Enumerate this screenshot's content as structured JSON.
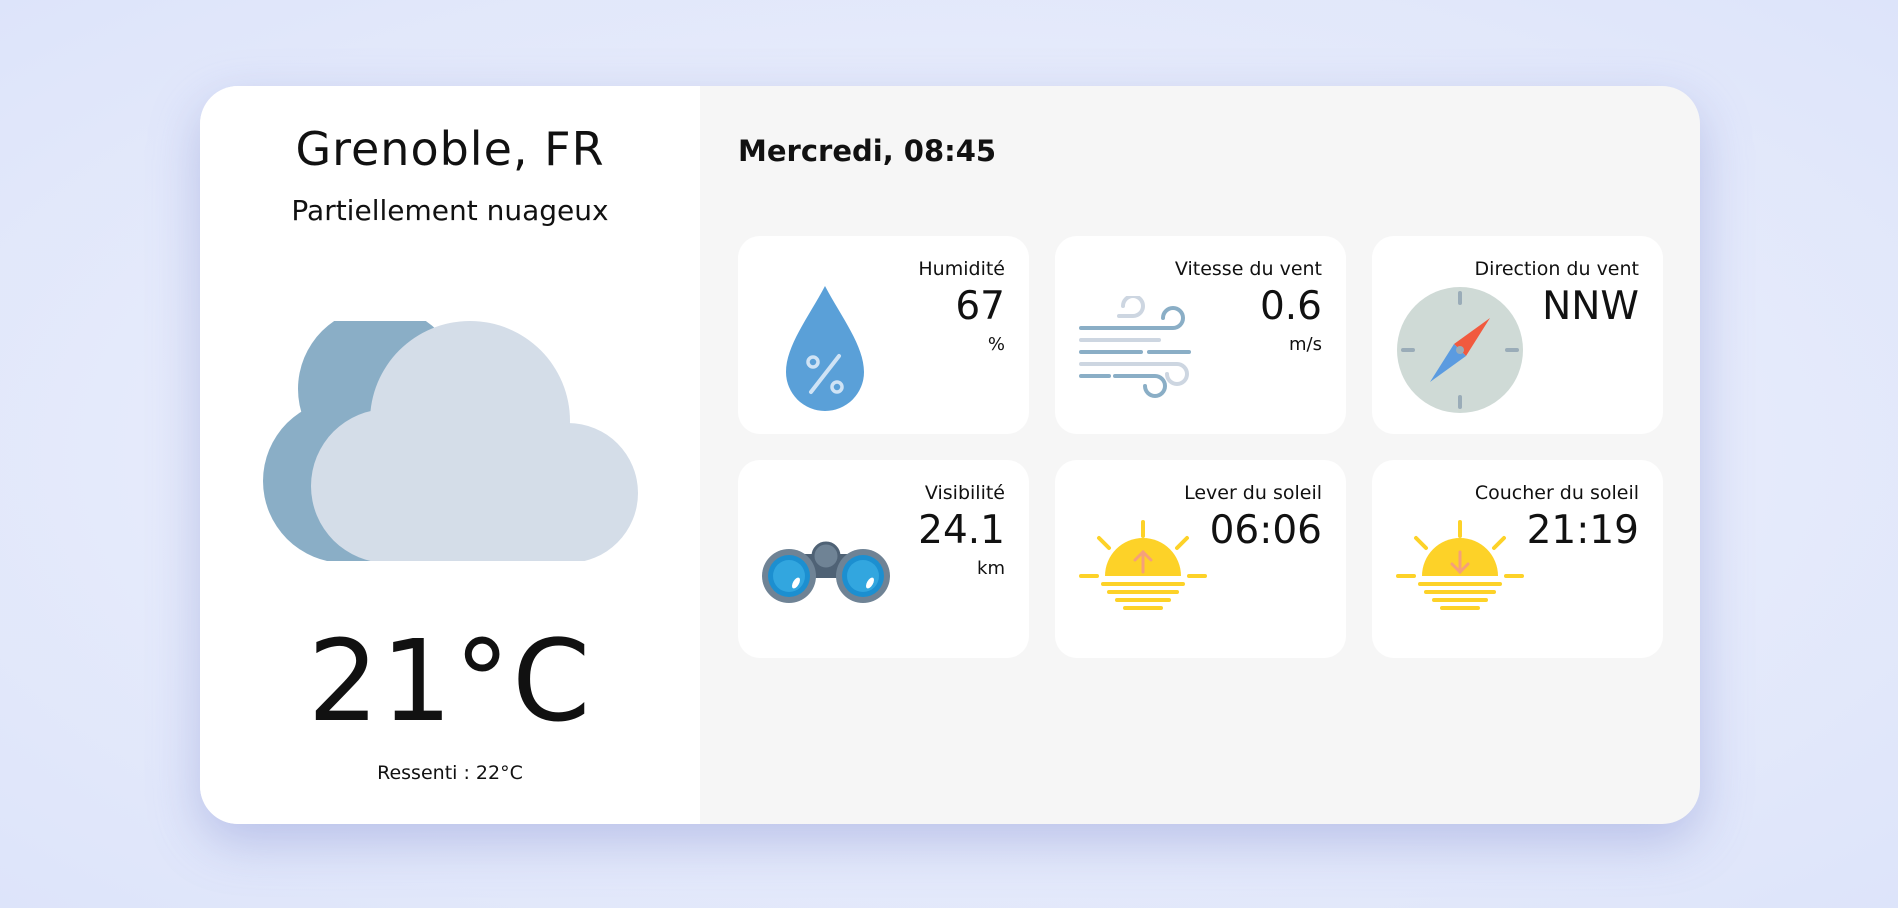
{
  "location": {
    "city": "Grenoble, FR",
    "condition": "Partiellement nuageux"
  },
  "current": {
    "temperature": "21°C",
    "feels_like": "Ressenti : 22°C"
  },
  "datetime": "Mercredi, 08:45",
  "tiles": [
    {
      "label": "Humidité",
      "value": "67",
      "unit": "%",
      "icon": "humidity-drop-icon"
    },
    {
      "label": "Vitesse du vent",
      "value": "0.6",
      "unit": "m/s",
      "icon": "wind-icon"
    },
    {
      "label": "Direction du vent",
      "value": "NNW",
      "icon": "compass-icon"
    },
    {
      "label": "Visibilité",
      "value": "24.1",
      "unit": "km",
      "icon": "binoculars-icon"
    },
    {
      "label": "Lever du soleil",
      "value": "06:06",
      "icon": "sunrise-icon"
    },
    {
      "label": "Coucher du soleil",
      "value": "21:19",
      "icon": "sunset-icon"
    }
  ],
  "colors": {
    "cloud_front": "#d4dde8",
    "cloud_back": "#8aaec6",
    "drop": "#5aa0d8",
    "sun": "#fdd228",
    "compass_red": "#f15a3f",
    "compass_blue": "#5b9be0"
  }
}
